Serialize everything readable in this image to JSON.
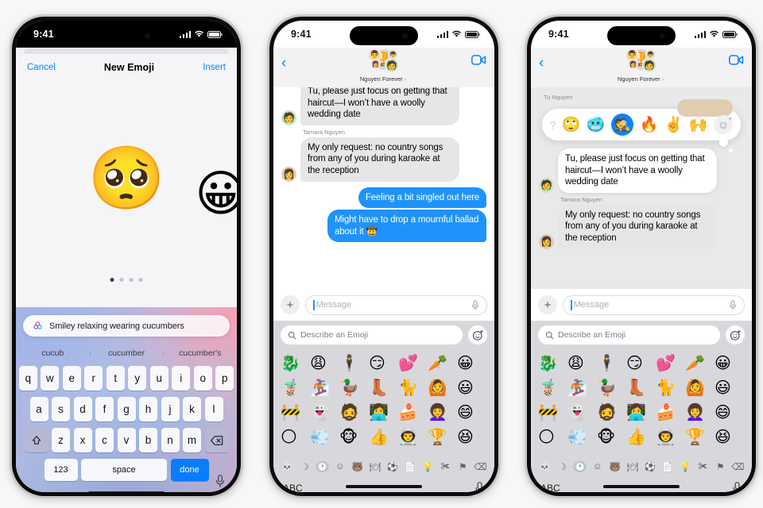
{
  "status_bar": {
    "time": "9:41",
    "signal_icon": "cellular-bars-icon",
    "wifi_icon": "wifi-icon",
    "battery_icon": "battery-icon"
  },
  "phone1": {
    "nav": {
      "cancel": "Cancel",
      "title": "New Emoji",
      "insert": "Insert"
    },
    "preview": {
      "main_emoji": "🥺",
      "side_emoji": "😀",
      "page_count": 4,
      "active_page": 1
    },
    "suggestion": {
      "icon": "genmoji-icon",
      "text": "Smiley relaxing wearing cucumbers"
    },
    "predictions": [
      "cucub",
      "cucumber",
      "cucumber's"
    ],
    "keyboard": {
      "row1": [
        "q",
        "w",
        "e",
        "r",
        "t",
        "y",
        "u",
        "i",
        "o",
        "p"
      ],
      "row2": [
        "a",
        "s",
        "d",
        "f",
        "g",
        "h",
        "j",
        "k",
        "l"
      ],
      "row3": [
        "z",
        "x",
        "c",
        "v",
        "b",
        "n",
        "m"
      ],
      "shift_icon": "shift-icon",
      "backspace_icon": "backspace-icon",
      "numbers_key": "123",
      "space_key": "space",
      "done_key": "done",
      "mic_icon": "microphone-icon"
    }
  },
  "phone2": {
    "header": {
      "back_icon": "back-chevron-icon",
      "group_name": "Nguyen Forever",
      "chevron": "›",
      "group_avatar_center": "🏆",
      "group_avatar_members": [
        "👨",
        "👩",
        "👦",
        "🧑"
      ],
      "video_icon": "facetime-video-icon"
    },
    "messages": [
      {
        "side": "in",
        "sender": "",
        "text": "Tu, please just focus on getting that haircut—I won’t have a woolly wedding date",
        "clipped": true,
        "avatar": "🧑"
      },
      {
        "side": "in",
        "sender": "Tamara Nguyen",
        "text": "My only request: no country songs from any of you during karaoke at the reception",
        "clipped": false,
        "avatar": "👩"
      },
      {
        "side": "out",
        "sender": "",
        "text": "Feeling a bit singled out here",
        "clipped": false,
        "avatar": ""
      },
      {
        "side": "out",
        "sender": "",
        "text": "Might have to drop a mournful ballad about it 🤠",
        "clipped": false,
        "avatar": ""
      }
    ],
    "input": {
      "plus_icon": "plus-icon",
      "placeholder": "Message",
      "mic_icon": "microphone-icon"
    },
    "emoji_keyboard": {
      "search_placeholder": "Describe an Emoji",
      "search_icon": "search-icon",
      "genmoji_button_icon": "genmoji-create-icon",
      "rows": [
        [
          "🐉",
          "😩",
          "🕴️",
          "😏",
          "💕",
          "🥕",
          "😀"
        ],
        [
          "🧋",
          "🏂",
          "🦆",
          "👢",
          "🐈",
          "🙆",
          "😃"
        ],
        [
          "🚧",
          "👻",
          "🧔",
          "👩‍💻",
          "🍰",
          "👩‍🦱",
          "😄"
        ],
        [
          "🌕",
          "💨",
          "🐵",
          "👍",
          "👨‍🚀",
          "🏆",
          "😆"
        ]
      ],
      "categories": [
        "genmoji-icon",
        "sticker-icon",
        "recents-icon",
        "smileys-icon",
        "animals-icon",
        "food-icon",
        "activities-icon",
        "objects-icon",
        "symbols-icon",
        "people-icon",
        "flags-icon"
      ],
      "active_category_index": 2,
      "backspace_icon": "backspace-icon",
      "abc_label": "ABC",
      "mic_icon": "microphone-icon"
    }
  },
  "phone3": {
    "header": {
      "back_icon": "back-chevron-icon",
      "group_name": "Nguyen Forever",
      "chevron": "›",
      "group_avatar_center": "🏆",
      "video_icon": "facetime-video-icon"
    },
    "tapback": {
      "partial_label": "Tu Nguyen",
      "leading_icon": "question-mark-icon",
      "options": [
        "🙄",
        "🥶",
        "🕵️",
        "🔥",
        "✌️",
        "🙌"
      ],
      "selected_index": 2,
      "add_button_icon": "add-emoji-icon"
    },
    "messages": [
      {
        "side": "in",
        "sender": "",
        "text": "Tu, please just focus on getting that haircut—I won’t have a woolly wedding date",
        "style": "white",
        "avatar": "🧑"
      },
      {
        "side": "in",
        "sender": "Tamara Nguyen",
        "text": "My only request: no country songs from any of you during karaoke at the reception",
        "style": "gray",
        "avatar": "👩"
      }
    ],
    "input": {
      "plus_icon": "plus-icon",
      "placeholder": "Message",
      "mic_icon": "microphone-icon"
    },
    "emoji_keyboard": {
      "search_placeholder": "Describe an Emoji",
      "search_icon": "search-icon",
      "genmoji_button_icon": "genmoji-create-icon",
      "abc_label": "ABC",
      "backspace_icon": "backspace-icon",
      "mic_icon": "microphone-icon",
      "active_category_index": 2
    }
  },
  "colors": {
    "accent_blue": "#0a84ff",
    "bubble_out": "#1f93fb",
    "bubble_in": "#e6e6e8",
    "page_bg": "#f7f7f7",
    "keyboard_done": "#0a7cff"
  }
}
